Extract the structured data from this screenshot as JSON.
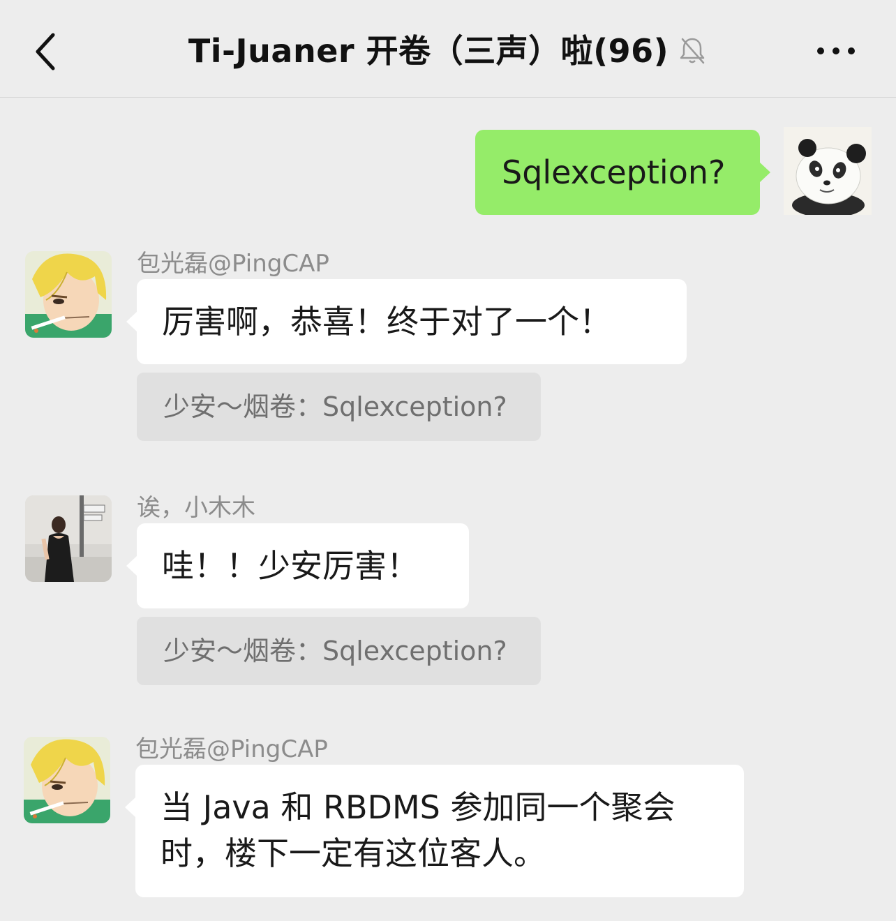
{
  "header": {
    "title": "Ti-Juaner 开卷（三声）啦(96)",
    "back_icon": "chevron-left-icon",
    "mute_icon": "bell-muted-icon",
    "more_icon": "more-dots-icon"
  },
  "colors": {
    "background": "#ededed",
    "self_bubble": "#95ec69",
    "other_bubble": "#ffffff",
    "quote_bg": "#e0e0e0"
  },
  "messages": [
    {
      "sender": "",
      "from_self": true,
      "text": "Sqlexception?"
    },
    {
      "sender": "包光磊@PingCAP",
      "from_self": false,
      "text": "厉害啊，恭喜！终于对了一个！",
      "quote": "少安～烟卷：Sqlexception?"
    },
    {
      "sender": "诶，小木木",
      "from_self": false,
      "text": "哇！！少安厉害！",
      "quote": "少安～烟卷：Sqlexception?"
    },
    {
      "sender": "包光磊@PingCAP",
      "from_self": false,
      "text_lines": [
        "当 Java 和 RBDMS 参加同一个聚会",
        "时，楼下一定有这位客人。"
      ]
    }
  ]
}
